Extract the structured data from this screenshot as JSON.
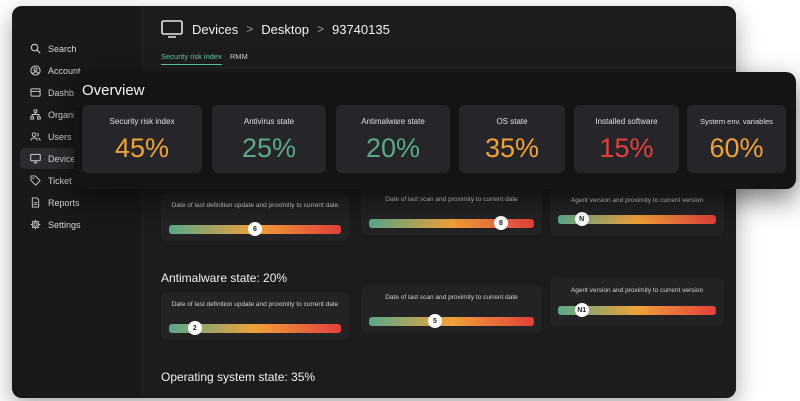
{
  "sidebar": {
    "items": [
      {
        "label": "Search",
        "icon": "search-icon"
      },
      {
        "label": "Account",
        "icon": "user-circle-icon"
      },
      {
        "label": "Dashbo",
        "icon": "dashboard-icon"
      },
      {
        "label": "Organi",
        "icon": "organization-icon"
      },
      {
        "label": "Users",
        "icon": "users-icon"
      },
      {
        "label": "Device",
        "icon": "monitor-icon",
        "active": true
      },
      {
        "label": "Ticket",
        "icon": "tag-icon"
      },
      {
        "label": "Reports",
        "icon": "document-icon"
      },
      {
        "label": "Settings",
        "icon": "gear-icon"
      }
    ]
  },
  "header": {
    "breadcrumb": [
      "Devices",
      "Desktop",
      "93740135"
    ]
  },
  "tabs": [
    {
      "label": "Security risk index",
      "active": true
    },
    {
      "label": "RMM",
      "active": false
    }
  ],
  "overview": {
    "title": "Overview",
    "cards": [
      {
        "label": "Security risk index",
        "value": "45%",
        "color": "#f0a13a"
      },
      {
        "label": "Antivirus state",
        "value": "25%",
        "color": "#5aa98a"
      },
      {
        "label": "Antimalware state",
        "value": "20%",
        "color": "#5aa98a"
      },
      {
        "label": "OS state",
        "value": "35%",
        "color": "#f0a13a"
      },
      {
        "label": "Installed software",
        "value": "15%",
        "color": "#e2403a"
      },
      {
        "label": "System env. variables",
        "value": "60%",
        "color": "#f0a13a"
      }
    ]
  },
  "sections": [
    {
      "title": "",
      "metrics": [
        {
          "label": "Date of last definition update and proximity to current date",
          "marker": "6",
          "position": 0.5
        },
        {
          "label": "Date of last scan and proximity to current date",
          "marker": "8",
          "position": 0.8
        },
        {
          "label": "Agent version and proximity to current version",
          "marker": "N",
          "position": 0.15
        }
      ]
    },
    {
      "title": "Antimalware state: 20%",
      "metrics": [
        {
          "label": "Date of last definition update and proximity to current date",
          "marker": "2",
          "position": 0.15
        },
        {
          "label": "Date of last scan and proximity to current date",
          "marker": "5",
          "position": 0.4
        },
        {
          "label": "Agent version and proximity to current version",
          "marker": "N1",
          "position": 0.15
        }
      ]
    },
    {
      "title": "Operating system state: 35%",
      "metrics": []
    }
  ],
  "colors": {
    "traffic_red": "#ff5f57",
    "traffic_yellow": "#febc2e",
    "traffic_green": "#28c840",
    "accent": "#5fc7a8",
    "gradient": "linear-gradient(90deg,#5aa98a,#f0a13a,#e2403a)"
  }
}
